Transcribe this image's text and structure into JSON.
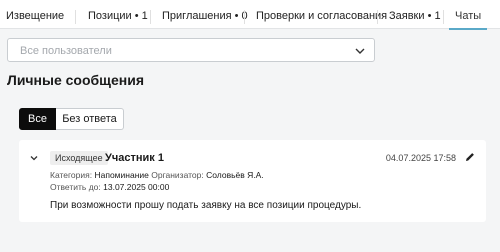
{
  "tabs": [
    {
      "label": "Извещение"
    },
    {
      "label": "Позиции • 1"
    },
    {
      "label": "Приглашения • 0"
    },
    {
      "label": "Проверки и согласования"
    },
    {
      "label": "Заявки • 1"
    },
    {
      "label": "Чаты",
      "active": true
    }
  ],
  "user_filter": {
    "placeholder": "Все пользователи"
  },
  "section_title": "Личные сообщения",
  "segments": {
    "all": "Все",
    "no_reply": "Без ответа"
  },
  "message": {
    "badge": "Исходящее",
    "participant": "Участник 1",
    "datetime": "04.07.2025 17:58",
    "category_label": "Категория:",
    "category_value": "Напоминание",
    "organizer_label": "Организатор:",
    "organizer_value": "Соловьёв Я.А.",
    "reply_label": "Ответить до:",
    "reply_value": "13.07.2025 00:00",
    "text": "При возможности прошу подать заявку на все позиции процедуры."
  },
  "colors": {
    "accent": "#5aa9c8",
    "active_segment": "#0c0c0c",
    "background": "#f4f5f6"
  }
}
